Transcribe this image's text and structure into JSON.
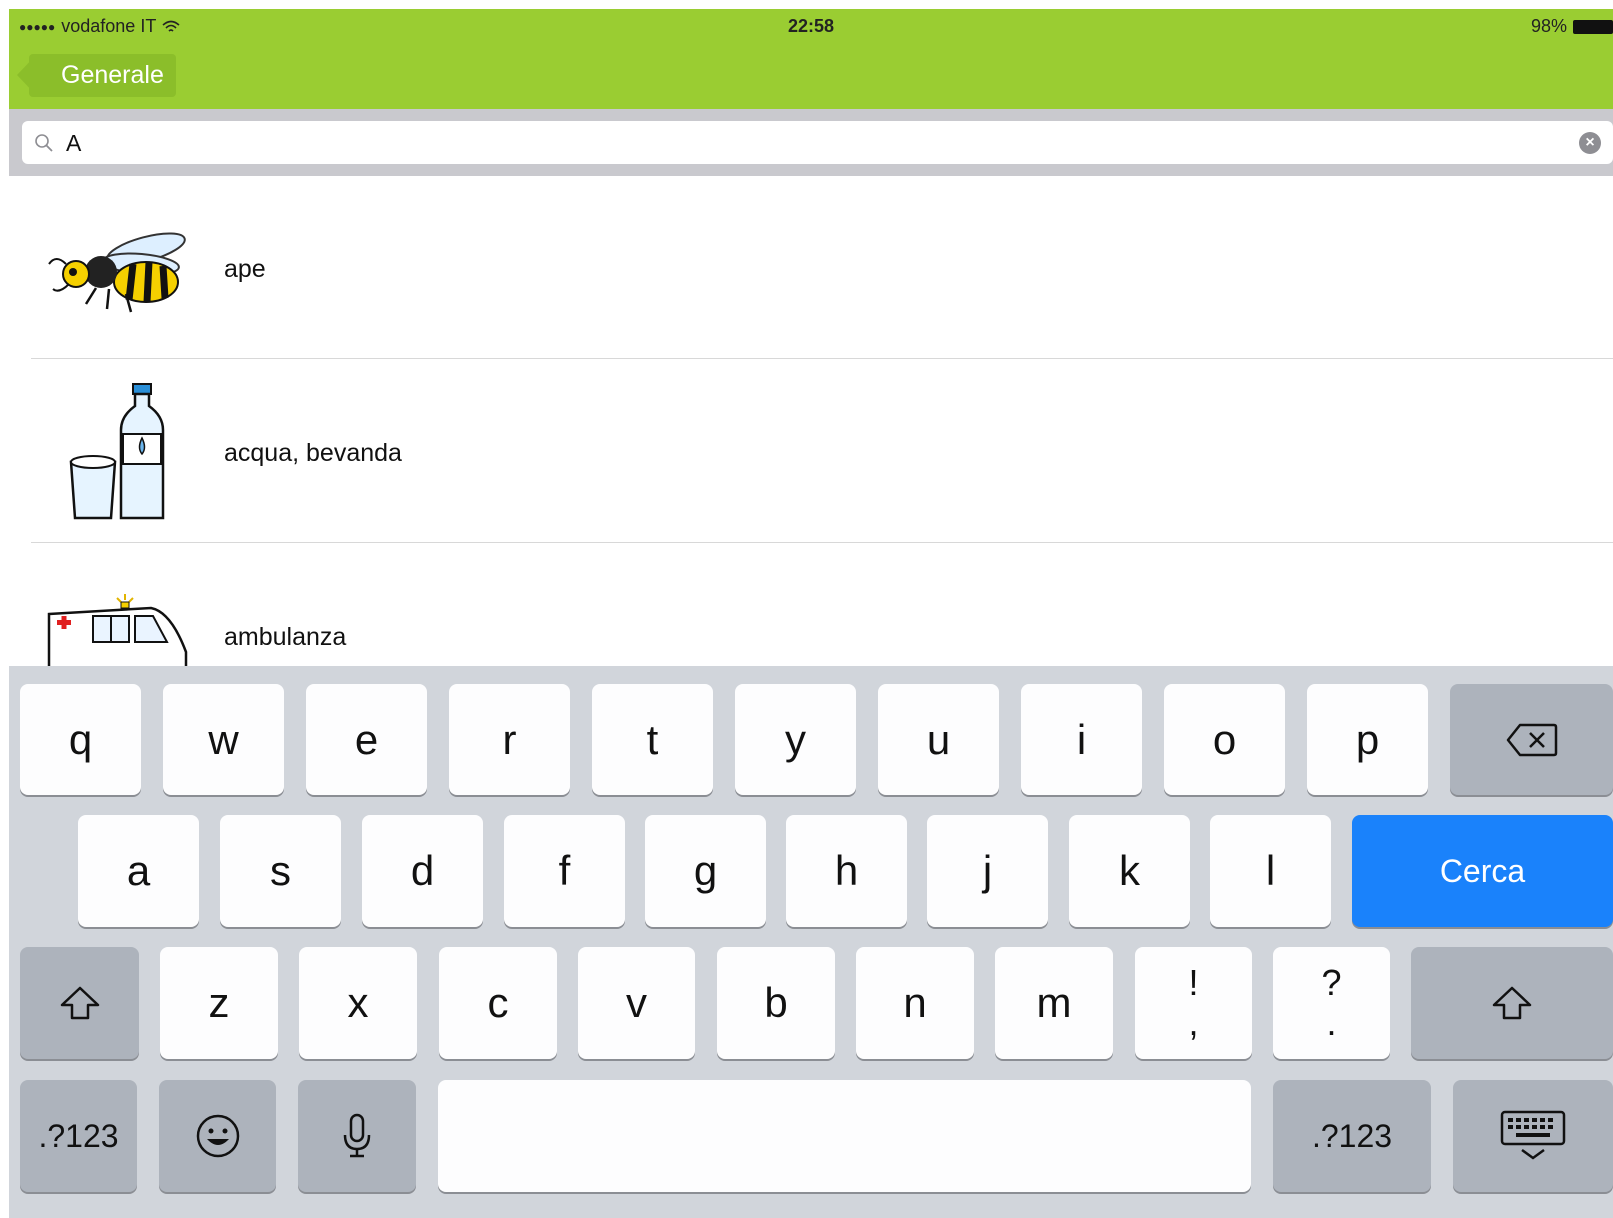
{
  "status_bar": {
    "signal_dots": "●●●●●",
    "carrier": "vodafone IT",
    "time": "22:58",
    "battery": "98%"
  },
  "nav": {
    "back_label": "Generale"
  },
  "search": {
    "value": "A"
  },
  "results": [
    {
      "label": "ape",
      "icon": "bee-icon"
    },
    {
      "label": "acqua, bevanda",
      "icon": "water-bottle-icon"
    },
    {
      "label": "ambulanza",
      "icon": "ambulance-icon"
    }
  ],
  "keyboard": {
    "row1": [
      "q",
      "w",
      "e",
      "r",
      "t",
      "y",
      "u",
      "i",
      "o",
      "p"
    ],
    "row2": [
      "a",
      "s",
      "d",
      "f",
      "g",
      "h",
      "j",
      "k",
      "l"
    ],
    "row3": [
      "z",
      "x",
      "c",
      "v",
      "b",
      "n",
      "m"
    ],
    "punct1": {
      "top": "!",
      "bottom": ","
    },
    "punct2": {
      "top": "?",
      "bottom": "."
    },
    "search_key": "Cerca",
    "numbers_key": ".?123",
    "colors": {
      "accent": "#1A82FB",
      "nav_green": "#9ACD32"
    }
  }
}
